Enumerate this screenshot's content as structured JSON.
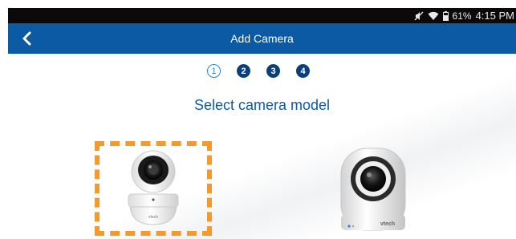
{
  "status_bar": {
    "battery": "61%",
    "time": "4:15 PM",
    "icons": [
      "mute-icon",
      "wifi-icon",
      "battery-icon"
    ]
  },
  "app_bar": {
    "title": "Add Camera",
    "back_icon": "chevron-left-icon"
  },
  "steps": [
    {
      "label": "1",
      "state": "current"
    },
    {
      "label": "2",
      "state": "todo"
    },
    {
      "label": "3",
      "state": "todo"
    },
    {
      "label": "4",
      "state": "todo"
    }
  ],
  "heading": "Select camera model",
  "camera_options": [
    {
      "brand": "vtech",
      "selected": true
    },
    {
      "brand": "vtech",
      "selected": false
    }
  ],
  "colors": {
    "app_bar": "#0b5aa3",
    "selection_border": "#f29a2e",
    "heading": "#0b5aa3"
  }
}
